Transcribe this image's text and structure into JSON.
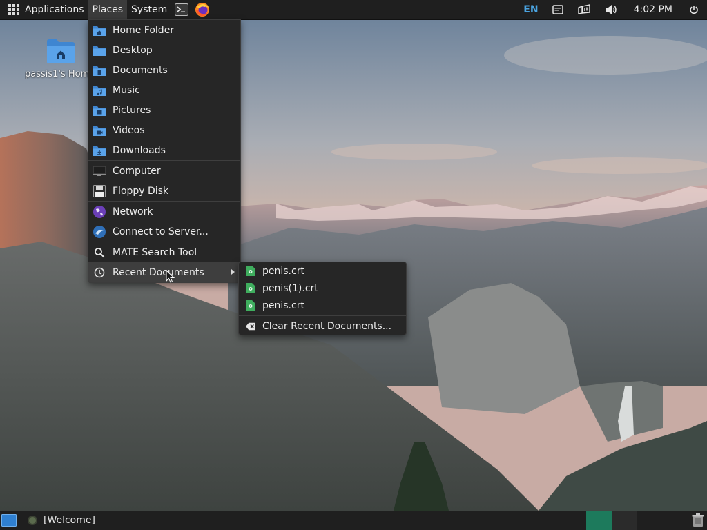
{
  "top_panel": {
    "menus": {
      "applications": "Applications",
      "places": "Places",
      "system": "System"
    },
    "launchers": [
      "terminal-icon",
      "firefox-icon"
    ],
    "tray": {
      "keyboard_layout": "EN",
      "clock": "4:02 PM"
    }
  },
  "desktop": {
    "home_icon_label": "passis1's Home"
  },
  "places_menu": {
    "items": [
      {
        "label": "Home Folder",
        "icon": "home-folder-icon"
      },
      {
        "label": "Desktop",
        "icon": "desktop-folder-icon"
      },
      {
        "label": "Documents",
        "icon": "documents-folder-icon"
      },
      {
        "label": "Music",
        "icon": "music-folder-icon"
      },
      {
        "label": "Pictures",
        "icon": "pictures-folder-icon"
      },
      {
        "label": "Videos",
        "icon": "videos-folder-icon"
      },
      {
        "label": "Downloads",
        "icon": "downloads-folder-icon"
      },
      {
        "label": "Computer",
        "icon": "computer-icon"
      },
      {
        "label": "Floppy Disk",
        "icon": "floppy-disk-icon"
      },
      {
        "label": "Network",
        "icon": "network-icon"
      },
      {
        "label": "Connect to Server...",
        "icon": "connect-server-icon"
      },
      {
        "label": "MATE Search Tool",
        "icon": "search-icon"
      },
      {
        "label": "Recent Documents",
        "icon": "clock-icon"
      }
    ]
  },
  "recent_documents": {
    "files": [
      "penis.crt",
      "penis(1).crt",
      "penis.crt"
    ],
    "clear_label": "Clear Recent Documents..."
  },
  "bottom_panel": {
    "task_label": "[Welcome]"
  },
  "colors": {
    "panel_bg": "#1f1f1f",
    "menu_bg": "#262626",
    "accent_blue": "#4aa3e0",
    "workspace_active": "#1d7a5c"
  }
}
